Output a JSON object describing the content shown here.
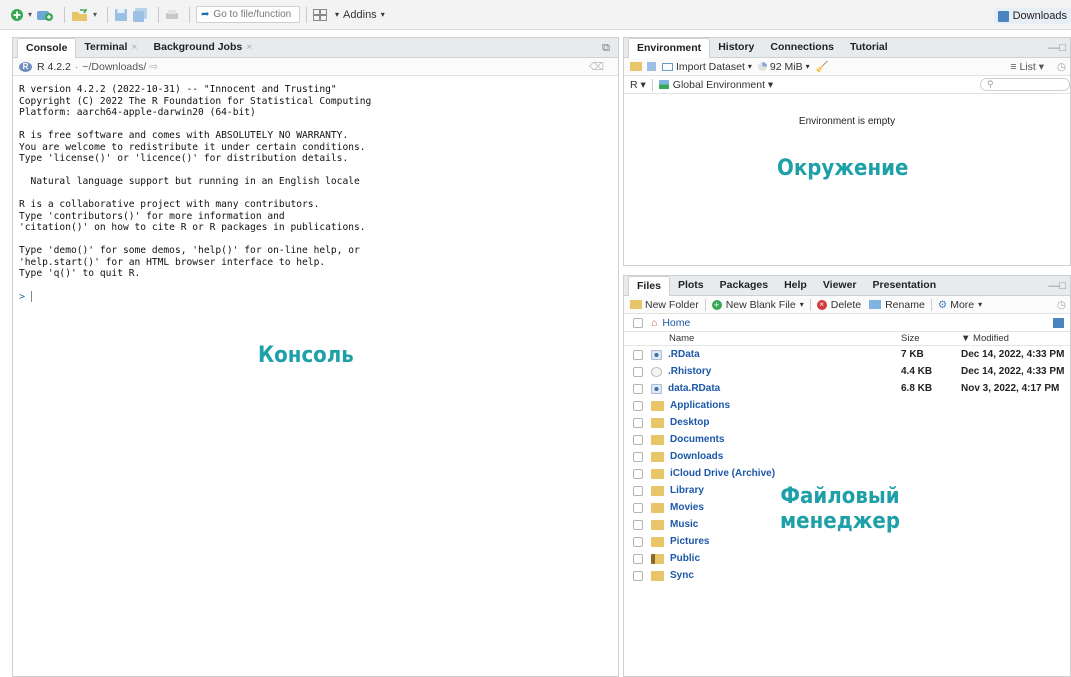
{
  "toolbar": {
    "goto_placeholder": "Go to file/function",
    "addins_label": "Addins",
    "project_label": "Downloads"
  },
  "console_pane": {
    "tabs": [
      {
        "label": "Console"
      },
      {
        "label": "Terminal"
      },
      {
        "label": "Background Jobs"
      }
    ],
    "version": "R 4.2.2",
    "path": "~/Downloads/",
    "output": "R version 4.2.2 (2022-10-31) -- \"Innocent and Trusting\"\nCopyright (C) 2022 The R Foundation for Statistical Computing\nPlatform: aarch64-apple-darwin20 (64-bit)\n\nR is free software and comes with ABSOLUTELY NO WARRANTY.\nYou are welcome to redistribute it under certain conditions.\nType 'license()' or 'licence()' for distribution details.\n\n  Natural language support but running in an English locale\n\nR is a collaborative project with many contributors.\nType 'contributors()' for more information and\n'citation()' on how to cite R or R packages in publications.\n\nType 'demo()' for some demos, 'help()' for on-line help, or\n'help.start()' for an HTML browser interface to help.\nType 'q()' to quit R.",
    "prompt": ">"
  },
  "env_pane": {
    "tabs": [
      {
        "label": "Environment"
      },
      {
        "label": "History"
      },
      {
        "label": "Connections"
      },
      {
        "label": "Tutorial"
      }
    ],
    "import_dataset": "Import Dataset",
    "memory": "92 MiB",
    "list_label": "List",
    "lang": "R",
    "scope": "Global Environment",
    "empty_message": "Environment is empty"
  },
  "files_pane": {
    "tabs": [
      {
        "label": "Files"
      },
      {
        "label": "Plots"
      },
      {
        "label": "Packages"
      },
      {
        "label": "Help"
      },
      {
        "label": "Viewer"
      },
      {
        "label": "Presentation"
      }
    ],
    "actions": {
      "new_folder": "New Folder",
      "new_blank_file": "New Blank File",
      "delete": "Delete",
      "rename": "Rename",
      "more": "More"
    },
    "breadcrumb": "Home",
    "columns": {
      "name": "Name",
      "size": "Size",
      "modified": "▼ Modified"
    },
    "files": [
      {
        "name": ".RData",
        "size": "7 KB",
        "modified": "Dec 14, 2022, 4:33 PM",
        "icon": "rdata-icon"
      },
      {
        "name": ".Rhistory",
        "size": "4.4 KB",
        "modified": "Dec 14, 2022, 4:33 PM",
        "icon": "rhistory-icon"
      },
      {
        "name": "data.RData",
        "size": "6.8 KB",
        "modified": "Nov 3, 2022, 4:17 PM",
        "icon": "rdata-icon"
      },
      {
        "name": "Applications",
        "size": "",
        "modified": "",
        "icon": "folder-icon"
      },
      {
        "name": "Desktop",
        "size": "",
        "modified": "",
        "icon": "folder-icon"
      },
      {
        "name": "Documents",
        "size": "",
        "modified": "",
        "icon": "folder-icon"
      },
      {
        "name": "Downloads",
        "size": "",
        "modified": "",
        "icon": "folder-icon"
      },
      {
        "name": "iCloud Drive (Archive)",
        "size": "",
        "modified": "",
        "icon": "folder-icon"
      },
      {
        "name": "Library",
        "size": "",
        "modified": "",
        "icon": "folder-icon"
      },
      {
        "name": "Movies",
        "size": "",
        "modified": "",
        "icon": "folder-icon"
      },
      {
        "name": "Music",
        "size": "",
        "modified": "",
        "icon": "folder-icon"
      },
      {
        "name": "Pictures",
        "size": "",
        "modified": "",
        "icon": "folder-icon"
      },
      {
        "name": "Public",
        "size": "",
        "modified": "",
        "icon": "public-folder-icon"
      },
      {
        "name": "Sync",
        "size": "",
        "modified": "",
        "icon": "folder-icon"
      }
    ]
  },
  "annotations": {
    "console": "Консоль",
    "environment": "Окружение",
    "files_line1": "Файловый",
    "files_line2": "менеджер"
  },
  "colors": {
    "annotation": "#1ea0a8",
    "link": "#1c58a8",
    "folder": "#e9c56a"
  }
}
